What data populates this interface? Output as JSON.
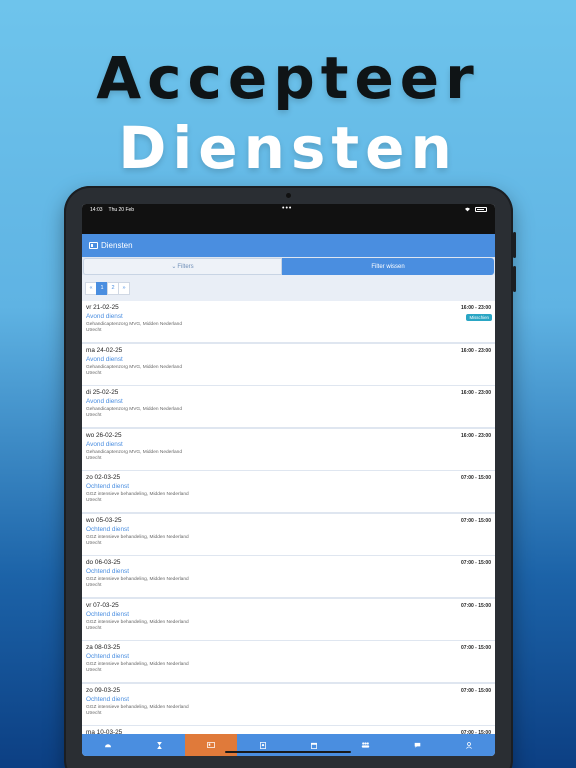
{
  "hero": {
    "line1": "Accepteer",
    "line2": "Diensten"
  },
  "status_bar": {
    "time": "14:03",
    "date": "Thu 20 Feb",
    "dots": "•••"
  },
  "app_bar": {
    "title": "Diensten"
  },
  "filters": {
    "filters_label": "Filters",
    "clear_label": "Filter wissen"
  },
  "pagination": {
    "prev": "«",
    "pages": [
      "1",
      "2"
    ],
    "next": "»",
    "active_page": "1"
  },
  "shifts": [
    {
      "date": "vr 21-02-25",
      "type": "Avond dienst",
      "org": "Gehandicaptenzorg MVG, Midden Nederland",
      "city": "Utrecht",
      "time": "16:00 - 23:00",
      "badge": "Misschien"
    },
    {
      "date": "ma 24-02-25",
      "type": "Avond dienst",
      "org": "Gehandicaptenzorg MVG, Midden Nederland",
      "city": "Utrecht",
      "time": "16:00 - 23:00"
    },
    {
      "date": "di 25-02-25",
      "type": "Avond dienst",
      "org": "Gehandicaptenzorg MVG, Midden Nederland",
      "city": "Utrecht",
      "time": "16:00 - 23:00"
    },
    {
      "date": "wo 26-02-25",
      "type": "Avond dienst",
      "org": "Gehandicaptenzorg MVG, Midden Nederland",
      "city": "Utrecht",
      "time": "16:00 - 23:00"
    },
    {
      "date": "zo 02-03-25",
      "type": "Ochtend dienst",
      "org": "GGZ intensieve behandeling, Midden Nederland",
      "city": "Utrecht",
      "time": "07:00 - 15:00"
    },
    {
      "date": "wo 05-03-25",
      "type": "Ochtend dienst",
      "org": "GGZ intensieve behandeling, Midden Nederland",
      "city": "Utrecht",
      "time": "07:00 - 15:00"
    },
    {
      "date": "do 06-03-25",
      "type": "Ochtend dienst",
      "org": "GGZ intensieve behandeling, Midden Nederland",
      "city": "Utrecht",
      "time": "07:00 - 15:00"
    },
    {
      "date": "vr 07-03-25",
      "type": "Ochtend dienst",
      "org": "GGZ intensieve behandeling, Midden Nederland",
      "city": "Utrecht",
      "time": "07:00 - 15:00"
    },
    {
      "date": "za 08-03-25",
      "type": "Ochtend dienst",
      "org": "GGZ intensieve behandeling, Midden Nederland",
      "city": "Utrecht",
      "time": "07:00 - 15:00"
    },
    {
      "date": "zo 09-03-25",
      "type": "Ochtend dienst",
      "org": "GGZ intensieve behandeling, Midden Nederland",
      "city": "Utrecht",
      "time": "07:00 - 15:00"
    },
    {
      "date": "ma 10-03-25",
      "type": "",
      "org": "",
      "city": "",
      "time": "07:00 - 15:00"
    }
  ],
  "tab_bar": {
    "active_index": 2,
    "tabs": [
      {
        "icon": "dashboard-icon"
      },
      {
        "icon": "hourglass-icon"
      },
      {
        "icon": "id-card-icon"
      },
      {
        "icon": "contact-icon"
      },
      {
        "icon": "calendar-icon"
      },
      {
        "icon": "users-icon"
      },
      {
        "icon": "chat-icon"
      },
      {
        "icon": "user-icon"
      }
    ]
  },
  "colors": {
    "primary": "#4a8ee0",
    "accent": "#e07a3a",
    "badge": "#2aa6c4"
  }
}
